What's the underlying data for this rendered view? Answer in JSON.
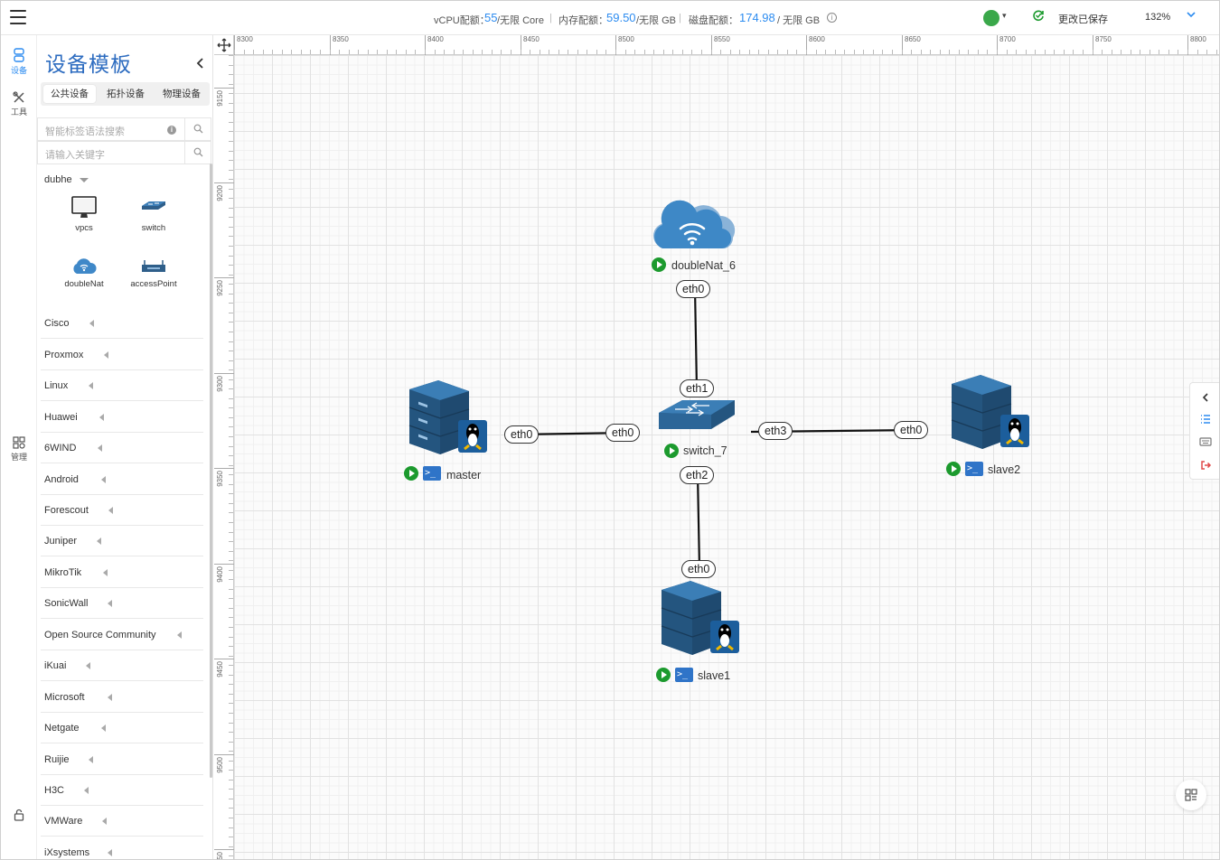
{
  "topbar": {
    "vcpu_label": "vCPU配额：",
    "vcpu_value": "55",
    "vcpu_unit": "/无限 Core",
    "mem_label": "内存配额：",
    "mem_value": "59.50",
    "mem_unit": "/无限 GB",
    "disk_label": "磁盘配额：",
    "disk_value": "174.98",
    "disk_unit": " / 无限 GB",
    "save_status": "更改已保存",
    "zoom": "132%"
  },
  "rail": {
    "devices": "设备",
    "tools": "工具",
    "manage": "管理"
  },
  "panel": {
    "title": "设备模板",
    "tabs": [
      "公共设备",
      "拓扑设备",
      "物理设备"
    ],
    "search_placeholder": "智能标签语法搜索",
    "keyword_placeholder": "请输入关键字",
    "group": "dubhe",
    "devices": [
      "vpcs",
      "switch",
      "doubleNat",
      "accessPoint"
    ],
    "vendors": [
      "Cisco",
      "Proxmox",
      "Linux",
      "Huawei",
      "6WIND",
      "Android",
      "Forescout",
      "Juniper",
      "MikroTik",
      "SonicWall",
      "Open Source Community",
      "iKuai",
      "Microsoft",
      "Netgate",
      "Ruijie",
      "H3C",
      "VMWare",
      "iXsystems"
    ]
  },
  "ruler": {
    "x": [
      "8300",
      "8350",
      "8400",
      "8450",
      "8500",
      "8550",
      "8600",
      "8650",
      "8700",
      "8750",
      "8800"
    ],
    "y": [
      "9150",
      "9200",
      "9250",
      "9300",
      "9350",
      "9400",
      "9450",
      "9500",
      "9550"
    ]
  },
  "topology": {
    "nodes": {
      "cloud": "doubleNat_6",
      "switch": "switch_7",
      "master": "master",
      "slave1": "slave1",
      "slave2": "slave2"
    },
    "interfaces": {
      "cloud_eth0": "eth0",
      "switch_eth1": "eth1",
      "master_eth0": "eth0",
      "switch_eth0": "eth0",
      "switch_eth3": "eth3",
      "slave2_eth0": "eth0",
      "switch_eth2": "eth2",
      "slave1_eth0": "eth0"
    }
  }
}
